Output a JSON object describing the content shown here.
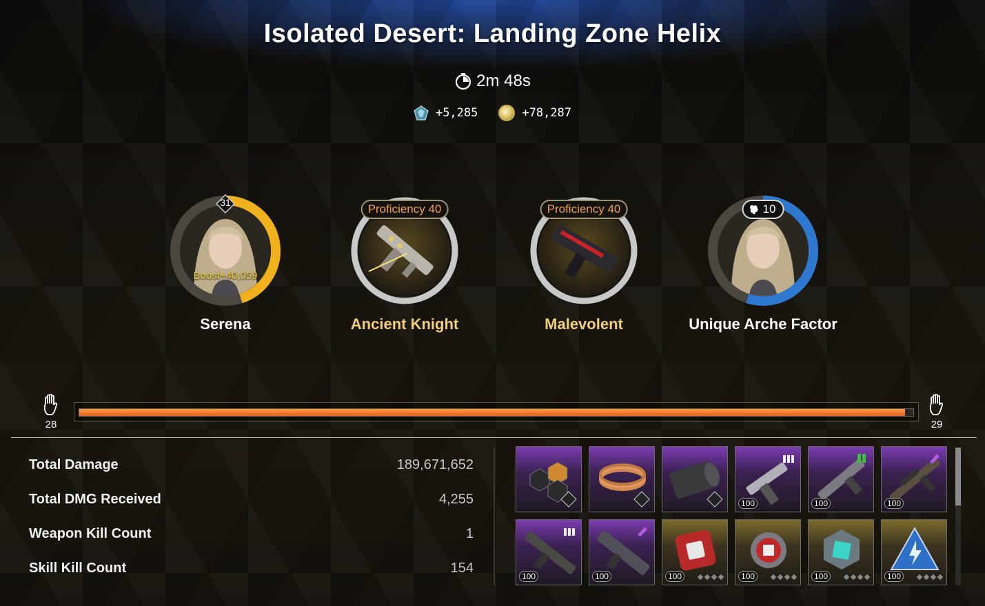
{
  "title": "Isolated Desert: Landing Zone Helix",
  "timer": "2m 48s",
  "rewards": [
    {
      "icon": "gem-icon",
      "amount": "+5,285"
    },
    {
      "icon": "gold-coin-icon",
      "amount": "+78,287"
    }
  ],
  "slots": {
    "character": {
      "name": "Serena",
      "level": "31",
      "boost": "Boost+40,059",
      "ring_progress": 0.45
    },
    "weapon1": {
      "name": "Ancient Knight",
      "proficiency": "Proficiency 40"
    },
    "weapon2": {
      "name": "Malevolent",
      "proficiency": "Proficiency 40"
    },
    "arche": {
      "name": "Unique Arche Factor",
      "level": "10",
      "ring_progress": 0.55
    }
  },
  "mastery": {
    "left": "28",
    "right": "29",
    "progress": 0.99
  },
  "stats": [
    {
      "label": "Total Damage",
      "value": "189,671,652"
    },
    {
      "label": "Total DMG Received",
      "value": "4,255"
    },
    {
      "label": "Weapon Kill Count",
      "value": "1"
    },
    {
      "label": "Skill Kill Count",
      "value": "154"
    }
  ],
  "items": [
    {
      "name": "hex-plate-material",
      "rarity": "purple",
      "count": ""
    },
    {
      "name": "copper-coil-material",
      "rarity": "purple",
      "count": ""
    },
    {
      "name": "fabric-roll-material",
      "rarity": "purple",
      "count": ""
    },
    {
      "name": "handgun",
      "rarity": "purple",
      "count": "100"
    },
    {
      "name": "scatter-gun",
      "rarity": "purple",
      "count": "100"
    },
    {
      "name": "sniper-rifle",
      "rarity": "purple",
      "count": "100"
    },
    {
      "name": "assault-rifle",
      "rarity": "purple",
      "count": "100"
    },
    {
      "name": "launcher",
      "rarity": "purple",
      "count": "100"
    },
    {
      "name": "red-module",
      "rarity": "gold",
      "count": "100"
    },
    {
      "name": "red-gear-module",
      "rarity": "gold",
      "count": "100"
    },
    {
      "name": "teal-module",
      "rarity": "gold",
      "count": "100"
    },
    {
      "name": "blue-triangle-module",
      "rarity": "gold",
      "count": "100"
    }
  ],
  "colors": {
    "accent_orange": "#e3601c",
    "gold_text": "#f1cf78",
    "ring_yellow": "#f0b21c",
    "ring_blue": "#2f78cf"
  }
}
